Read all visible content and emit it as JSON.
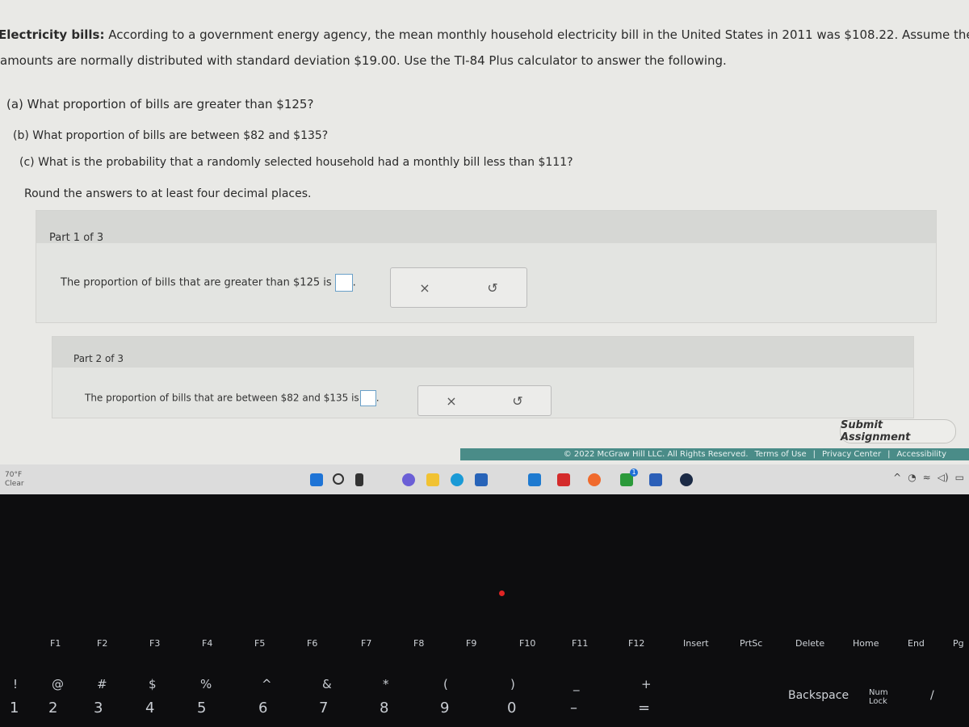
{
  "question": {
    "intro_bold": "Electricity bills:",
    "intro_line1": " According to a government energy agency, the mean monthly household electricity bill in the United States in 2011 was $108.22. Assume the",
    "intro_line2": "amounts are normally distributed with standard deviation $19.00. Use the TI-84 Plus calculator to answer the following.",
    "a": "(a) What proportion of bills are greater than $125?",
    "b": "(b) What proportion of bills are between $82 and $135?",
    "c": "(c) What is the probability that a randomly selected household had a monthly bill less than $111?",
    "round": "Round the answers to at least four decimal places."
  },
  "parts": [
    {
      "label": "Part 1 of 3",
      "text": "The proportion of bills that are greater than $125 is",
      "value": ""
    },
    {
      "label": "Part 2 of 3",
      "text": "The proportion of bills that are between $82 and $135 is",
      "value": ""
    }
  ],
  "tools": {
    "clear": "×",
    "undo": "↺"
  },
  "submit_label": "Submit Assignment",
  "footer": {
    "copyright": "© 2022 McGraw Hill LLC. All Rights Reserved.",
    "terms": "Terms of Use",
    "privacy": "Privacy Center",
    "accessibility": "Accessibility",
    "sep": "|"
  },
  "weather": {
    "temp": "70°F",
    "condition": "Clear"
  },
  "taskbar_icons": [
    "windows-start",
    "search",
    "task-view",
    "teams-chat",
    "file-explorer",
    "edge",
    "store",
    "app-l",
    "mcafee",
    "firefox",
    "xbox",
    "word",
    "steam"
  ],
  "xbox_badge": "1",
  "keyboard": {
    "fkeys": [
      "F1",
      "F2",
      "F3",
      "F4",
      "F5",
      "F6",
      "F7",
      "F8",
      "F9",
      "F10",
      "F11",
      "F12",
      "Insert",
      "PrtSc",
      "Delete",
      "Home",
      "End",
      "Pg"
    ],
    "numbers": [
      "1",
      "2",
      "3",
      "4",
      "5",
      "6",
      "7",
      "8",
      "9",
      "0",
      "–",
      "="
    ],
    "symbols": [
      "!",
      "@",
      "#",
      "$",
      "%",
      "^",
      "&",
      "*",
      "(",
      ")",
      "_",
      "+"
    ],
    "backspace": "Backspace",
    "numlock": "Num Lock",
    "slash": "/"
  }
}
